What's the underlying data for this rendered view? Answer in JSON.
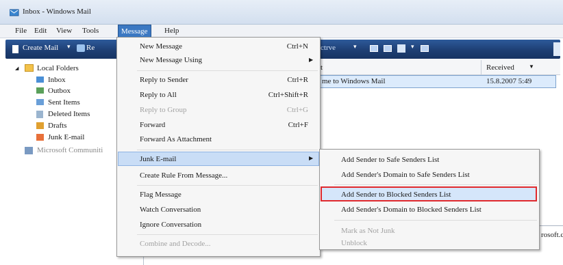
{
  "window": {
    "title": "Inbox - Windows Mail"
  },
  "menubar": {
    "items": [
      {
        "label": "File"
      },
      {
        "label": "Edit"
      },
      {
        "label": "View"
      },
      {
        "label": "Tools"
      },
      {
        "label": "Message"
      },
      {
        "label": "Help"
      }
    ]
  },
  "toolbar": {
    "create_mail": "Create Mail",
    "partial_label": "ctrve",
    "partial_re": "Re"
  },
  "folders": {
    "local_folders": "Local Folders",
    "inbox": "Inbox",
    "outbox": "Outbox",
    "sent": "Sent Items",
    "deleted": "Deleted Items",
    "drafts": "Drafts",
    "junk": "Junk E-mail",
    "microsoft": "Microsoft Communiti"
  },
  "message_list": {
    "subject_header_partial": "t",
    "received_header": "Received",
    "row_subject_partial": "me to Windows Mail",
    "row_received": "15.8.2007 5:49",
    "preview_partial": "rosoft.c"
  },
  "message_menu": {
    "new_message": "New Message",
    "new_message_sc": "Ctrl+N",
    "new_message_using": "New Message Using",
    "reply_sender": "Reply to Sender",
    "reply_sender_sc": "Ctrl+R",
    "reply_all": "Reply to All",
    "reply_all_sc": "Ctrl+Shift+R",
    "reply_group": "Reply to Group",
    "reply_group_sc": "Ctrl+G",
    "forward": "Forward",
    "forward_sc": "Ctrl+F",
    "forward_attach": "Forward As Attachment",
    "junk": "Junk E-mail",
    "create_rule": "Create Rule From Message...",
    "flag": "Flag Message",
    "watch": "Watch Conversation",
    "ignore": "Ignore Conversation",
    "combine": "Combine and Decode..."
  },
  "junk_submenu": {
    "add_safe": "Add Sender to Safe Senders List",
    "add_domain_safe": "Add Sender's Domain to Safe Senders List",
    "add_blocked": "Add Sender to Blocked Senders List",
    "add_domain_blocked": "Add Sender's Domain to Blocked Senders List",
    "mark_not_junk": "Mark as Not Junk",
    "unblock": "Unblock"
  }
}
